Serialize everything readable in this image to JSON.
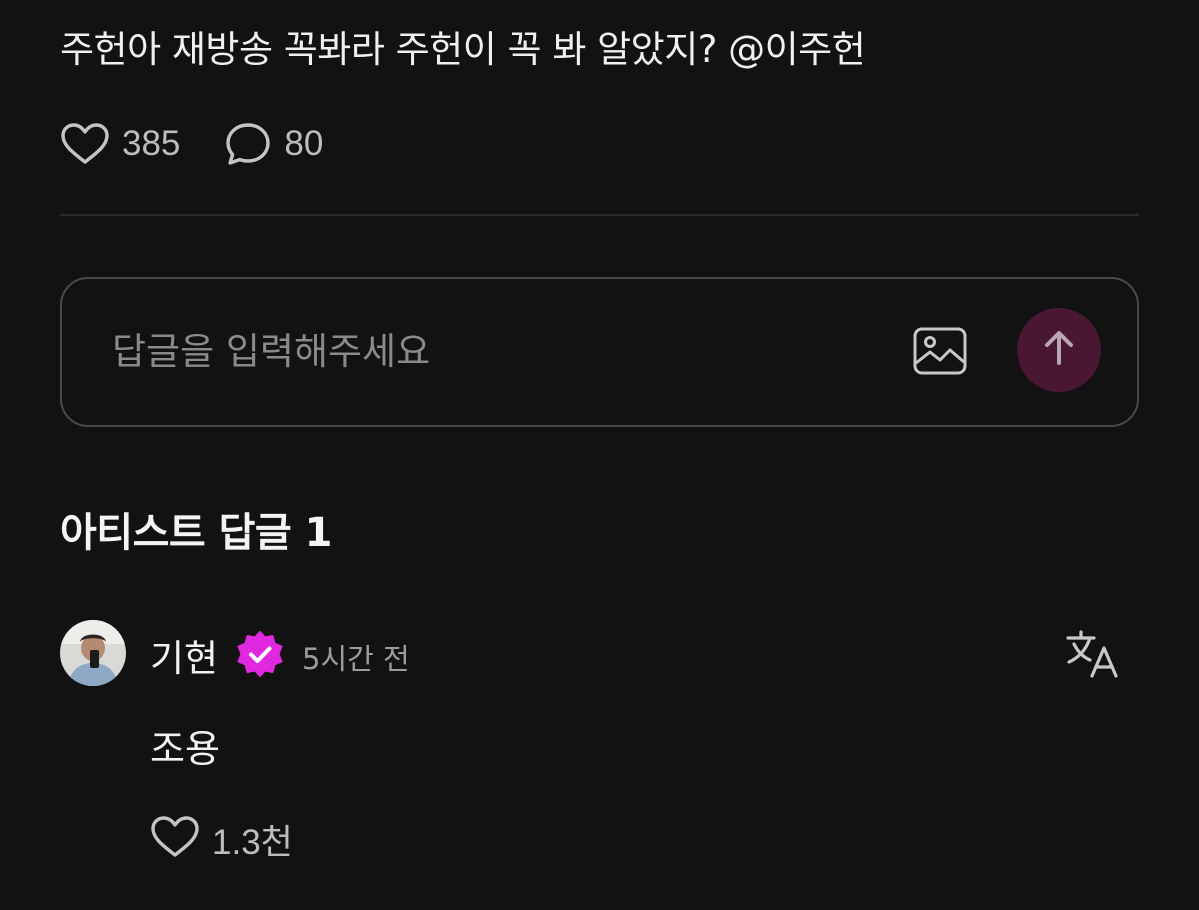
{
  "post": {
    "text": "주헌아 재방송 꼭봐라 주헌이 꼭 봐 알았지? @이주헌",
    "likes": "385",
    "comments": "80"
  },
  "reply": {
    "placeholder": "답글을 입력해주세요",
    "image_icon": "image-icon",
    "send_icon": "arrow-up-icon"
  },
  "section": {
    "title": "아티스트 답글 1"
  },
  "comment": {
    "author": "기현",
    "time": "5시간 전",
    "text": "조용",
    "likes": "1.3천",
    "verified_icon": "verified-badge-icon",
    "translate_icon": "translate-icon"
  },
  "colors": {
    "background": "#121212",
    "send_button": "#4a1733",
    "verified_badge": "#e028e0"
  }
}
